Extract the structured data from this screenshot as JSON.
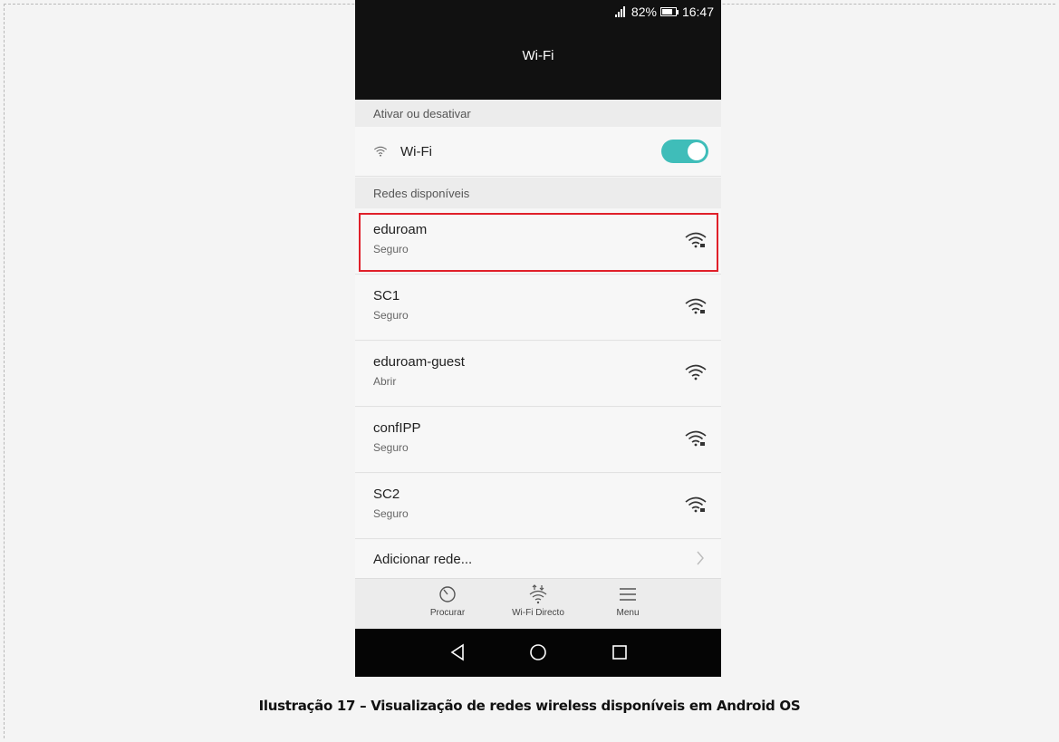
{
  "status_bar": {
    "battery": "82%",
    "time": "16:47"
  },
  "app_bar": {
    "title": "Wi-Fi"
  },
  "toggle_section": {
    "header": "Ativar ou desativar",
    "label": "Wi-Fi",
    "enabled": true
  },
  "networks_section": {
    "header": "Redes disponíveis"
  },
  "networks": [
    {
      "name": "eduroam",
      "status": "Seguro",
      "locked": true
    },
    {
      "name": "SC1",
      "status": "Seguro",
      "locked": true
    },
    {
      "name": "eduroam-guest",
      "status": "Abrir",
      "locked": false
    },
    {
      "name": "confIPP",
      "status": "Seguro",
      "locked": true
    },
    {
      "name": "SC2",
      "status": "Seguro",
      "locked": true
    }
  ],
  "add_network": {
    "label": "Adicionar rede..."
  },
  "actions": {
    "scan": "Procurar",
    "wifi_direct": "Wi-Fi Directo",
    "menu": "Menu"
  },
  "caption": "Ilustração 17 – Visualização de redes wireless disponíveis em Android OS",
  "colors": {
    "toggle_on": "#3fbdb9",
    "highlight": "#e0202a",
    "bar": "#111111"
  }
}
